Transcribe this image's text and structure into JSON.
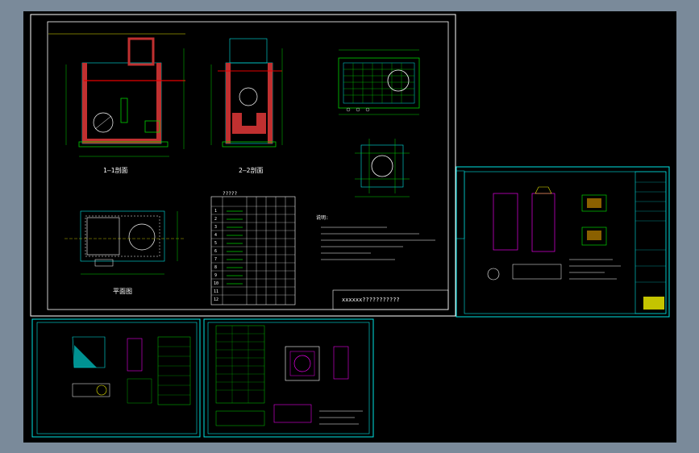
{
  "colors": {
    "canvas_bg": "#7a8a9a",
    "workspace": "#000000",
    "frame": "#ffffff",
    "cyan": "#00e5e5",
    "red": "#e60000",
    "green": "#00d000",
    "yellow": "#e6e600",
    "magenta": "#e600e6"
  },
  "main_sheet": {
    "section_1_label": "1—1剖面",
    "section_2_label": "2—2剖面",
    "plan_label": "平面图",
    "table_title": "?????",
    "table_rows": [
      "1",
      "2",
      "3",
      "4",
      "5",
      "6",
      "7",
      "8",
      "9",
      "10",
      "11",
      "12"
    ],
    "notes_title": "说明:",
    "title_block_text": "xxxxxx???????????"
  },
  "sheets": {
    "right": "sheet-right",
    "bottom_left": "sheet-bottom-left",
    "bottom_mid": "sheet-bottom-mid"
  }
}
